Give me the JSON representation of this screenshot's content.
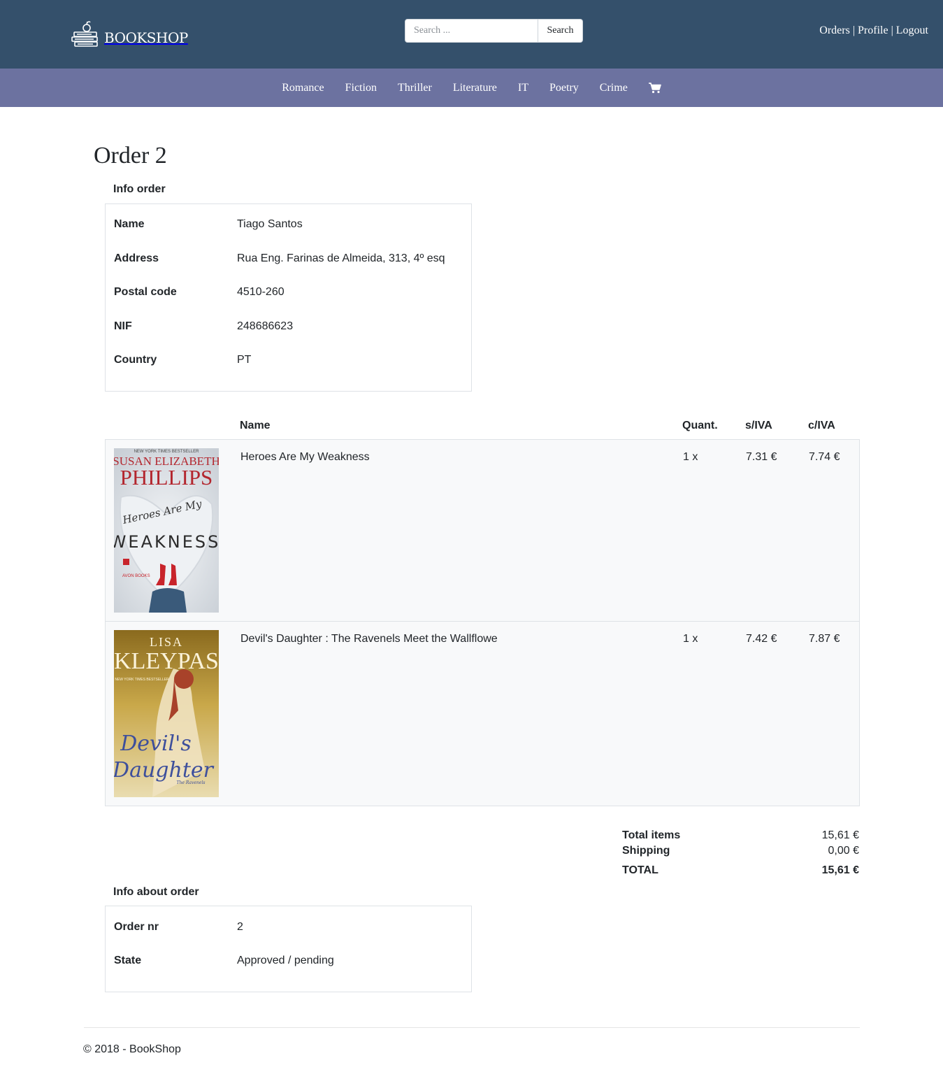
{
  "header": {
    "logo_text": "BOOKSHOP",
    "search_placeholder": "Search ...",
    "search_button": "Search",
    "links": {
      "orders": "Orders",
      "profile": "Profile",
      "logout": "Logout",
      "separator": "|"
    }
  },
  "categories": [
    "Romance",
    "Fiction",
    "Thriller",
    "Literature",
    "IT",
    "Poetry",
    "Crime"
  ],
  "cart_icon": "shopping-cart-icon",
  "page_title": "Order 2",
  "info_order": {
    "title": "Info order",
    "fields": [
      {
        "label": "Name",
        "value": "Tiago Santos"
      },
      {
        "label": "Address",
        "value": "Rua Eng. Farinas de Almeida, 313, 4º esq"
      },
      {
        "label": "Postal code",
        "value": "4510-260"
      },
      {
        "label": "NIF",
        "value": "248686623"
      },
      {
        "label": "Country",
        "value": "PT"
      }
    ]
  },
  "items_table": {
    "headers": {
      "name": "Name",
      "quantity": "Quant.",
      "price_no_vat": "s/IVA",
      "price_vat": "c/IVA"
    },
    "rows": [
      {
        "name": "Heroes Are My Weakness",
        "quantity": "1 x",
        "price_no_vat": "7.31 €",
        "price_vat": "7.74 €",
        "cover": {
          "top_line": "NEW YORK TIMES BESTSELLER",
          "author_first": "SUSAN ELIZABETH",
          "author_last": "PHILLIPS",
          "title_script": "Heroes Are My",
          "title_big": "WEAKNESS",
          "publisher": "AVON BOOKS"
        }
      },
      {
        "name": "Devil's Daughter : The Ravenels Meet the Wallflowe",
        "quantity": "1 x",
        "price_no_vat": "7.42 €",
        "price_vat": "7.87 €",
        "cover": {
          "author_first": "LISA",
          "author_last": "KLEYPAS",
          "tagline": "NEW YORK TIMES BESTSELLER",
          "title_1": "Devil's",
          "title_2": "Daughter",
          "series": "The Ravenels"
        }
      }
    ]
  },
  "totals": {
    "items_label": "Total items",
    "items_value": "15,61 €",
    "shipping_label": "Shipping",
    "shipping_value": "0,00 €",
    "total_label": "TOTAL",
    "total_value": "15,61 €"
  },
  "info_about_order": {
    "title": "Info about order",
    "fields": [
      {
        "label": "Order nr",
        "value": "2"
      },
      {
        "label": "State",
        "value": "Approved / pending"
      }
    ]
  },
  "footer": {
    "text": "© 2018 - BookShop"
  },
  "colors": {
    "header_bg": "#34506b",
    "nav_bg": "#6c72a0",
    "row_bg": "#f8f9fa",
    "border": "#dee2e6"
  }
}
